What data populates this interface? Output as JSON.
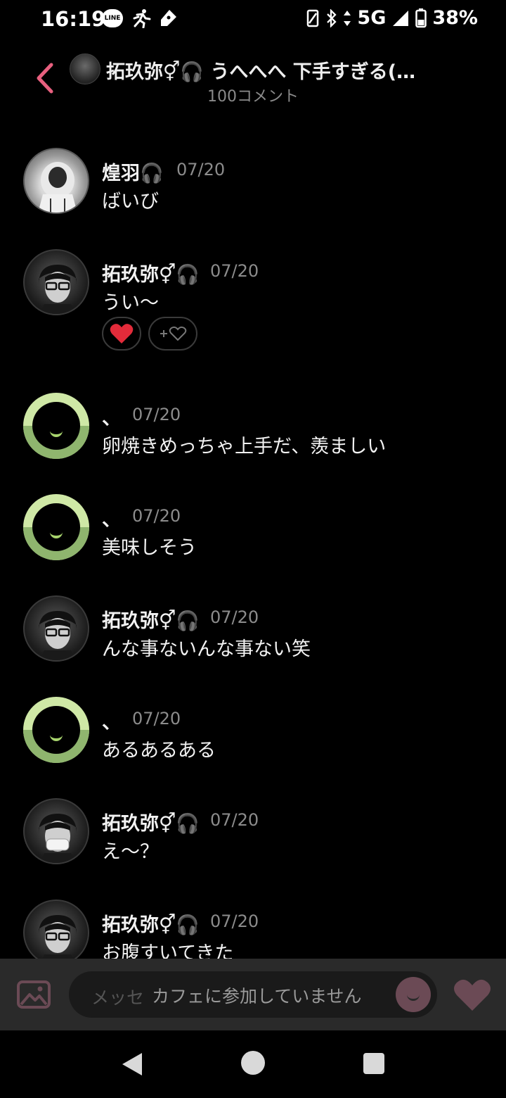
{
  "status": {
    "time": "16:19",
    "network": "5G",
    "battery": "38%",
    "line_label": "LINE"
  },
  "header": {
    "title": "拓玖弥⚥🎧 うへへへ 下手すぎる(…",
    "comment_count": "100コメント"
  },
  "comments": [
    {
      "name": "煌羽🎧",
      "date": "07/20",
      "text": "ばいび",
      "avatar": "photo-hood"
    },
    {
      "name": "拓玖弥⚥🎧",
      "date": "07/20",
      "text": "うい〜",
      "avatar": "photo-glasses",
      "reactions": [
        "❤️"
      ],
      "add_reaction": "+♡"
    },
    {
      "name": "、",
      "date": "07/20",
      "text": "卵焼きめっちゃ上手だ、羨ましい",
      "avatar": "default"
    },
    {
      "name": "、",
      "date": "07/20",
      "text": "美味しそう",
      "avatar": "default"
    },
    {
      "name": "拓玖弥⚥🎧",
      "date": "07/20",
      "text": "んな事ないんな事ない笑",
      "avatar": "photo-glasses"
    },
    {
      "name": "、",
      "date": "07/20",
      "text": "あるあるある",
      "avatar": "default"
    },
    {
      "name": "拓玖弥⚥🎧",
      "date": "07/20",
      "text": "え〜？",
      "avatar": "photo-glasses"
    },
    {
      "name": "拓玖弥⚥🎧",
      "date": "07/20",
      "text": "お腹すいてきた",
      "avatar": "photo-glasses"
    }
  ],
  "composer": {
    "placeholder": "メッセ",
    "notice": "カフェに参加していません"
  },
  "colors": {
    "accent_pink": "#e8607f",
    "default_avatar_light": "#cfe8a6",
    "default_avatar_dark": "#8fb56e",
    "like_heart": "#6b4a55"
  }
}
